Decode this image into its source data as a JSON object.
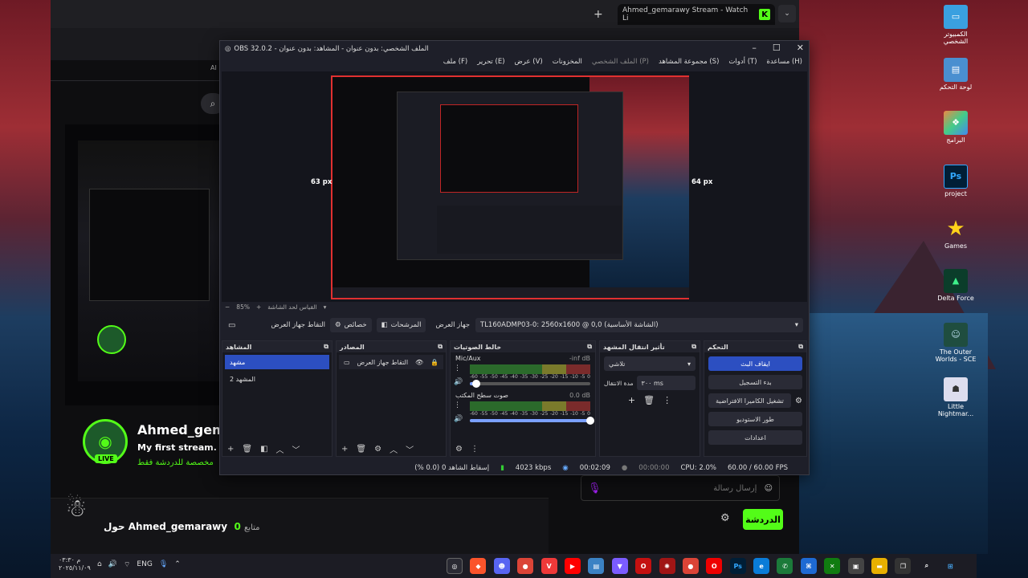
{
  "browser": {
    "tab_title": "Ahmed_gemarawy Stream - Watch Li",
    "tab_logo": "K",
    "new_tab": "+",
    "tab_close": "✕",
    "ai_label": "AI",
    "channel": {
      "name": "Ahmed_gem",
      "stream_title": "My first stream.",
      "category": "مخصصة للدردشة فقط",
      "live_badge": "LIVE",
      "followers_label": "متابع",
      "followers_count": "0",
      "about_label": "حول Ahmed_gemarawy"
    },
    "chat": {
      "input_placeholder": "إرسال رسالة",
      "send_button": "الدردشة"
    }
  },
  "obs": {
    "title": "OBS 32.0.2 - الملف الشخصي: بدون عنوان - المشاهد: بدون عنوان",
    "menu": [
      "ملف (F)",
      "تحرير (E)",
      "عرض (V)",
      "المخزونات",
      "الملف الشخصي (P)",
      "مجموعة المشاهد (S)",
      "أدوات (T)",
      "مساعدة (H)"
    ],
    "preview": {
      "left_px_label": "63 px",
      "right_px_label": "64 px"
    },
    "zoom_label": "85%",
    "zoom_hint": "القياس لحد الشاشة",
    "source_toolbar": {
      "capture_label": "التقاط جهاز العرض",
      "properties": "خصائص",
      "filters": "المرشحات",
      "device_label": "جهاز العرض",
      "device_value": "TL160ADMP03-0: 2560x1600 @ 0,0 (الشاشة الأساسية)"
    },
    "docks": {
      "scenes": {
        "title": "المشاهد",
        "items": [
          "مشهد",
          "المشهد 2"
        ]
      },
      "sources": {
        "title": "المصادر",
        "items": [
          "التقاط جهاز العرض"
        ]
      },
      "mixer": {
        "title": "خالط الصوتيات",
        "channels": [
          {
            "name": "Mic/Aux",
            "value": "-inf dB",
            "volume": 0.05
          },
          {
            "name": "صوت سطح المكتب",
            "value": "0.0 dB",
            "volume": 1.0
          }
        ],
        "scale": [
          "-60",
          "-55",
          "-50",
          "-45",
          "-40",
          "-35",
          "-30",
          "-25",
          "-20",
          "-15",
          "-10",
          "-5",
          "0"
        ]
      },
      "transitions": {
        "title": "تأثير انتقال المشهد",
        "type": "تلاشي",
        "duration_label": "مدة الانتقال",
        "duration_value": "٣٠٠ ms"
      },
      "controls": {
        "title": "التحكم",
        "buttons": [
          "ايقاف البث",
          "بدء التسجيل",
          "تشغيل الكاميرا الافتراضية",
          "طور الاستوديو",
          "اعدادات"
        ]
      }
    },
    "status": {
      "dropped": "إسقاط الشاهد 0 (0.0 %)",
      "bitrate": "4023 kbps",
      "stream_time": "00:02:09",
      "rec_time": "00:00:00",
      "cpu": "CPU: 2.0%",
      "fps": "60.00 / 60.00 FPS"
    }
  },
  "desktop": {
    "icons": [
      "الكمبيوتر الشخصي",
      "لوحة التحكم",
      "البرامج",
      "project",
      "Games",
      "Delta Force",
      "The Outer Worlds - SCE",
      "Little Nightmar..."
    ]
  },
  "taskbar": {
    "time": "م ٠٣:٣٠",
    "date": "٢٠٢٥/١١/٠٩",
    "lang": "ENG"
  }
}
